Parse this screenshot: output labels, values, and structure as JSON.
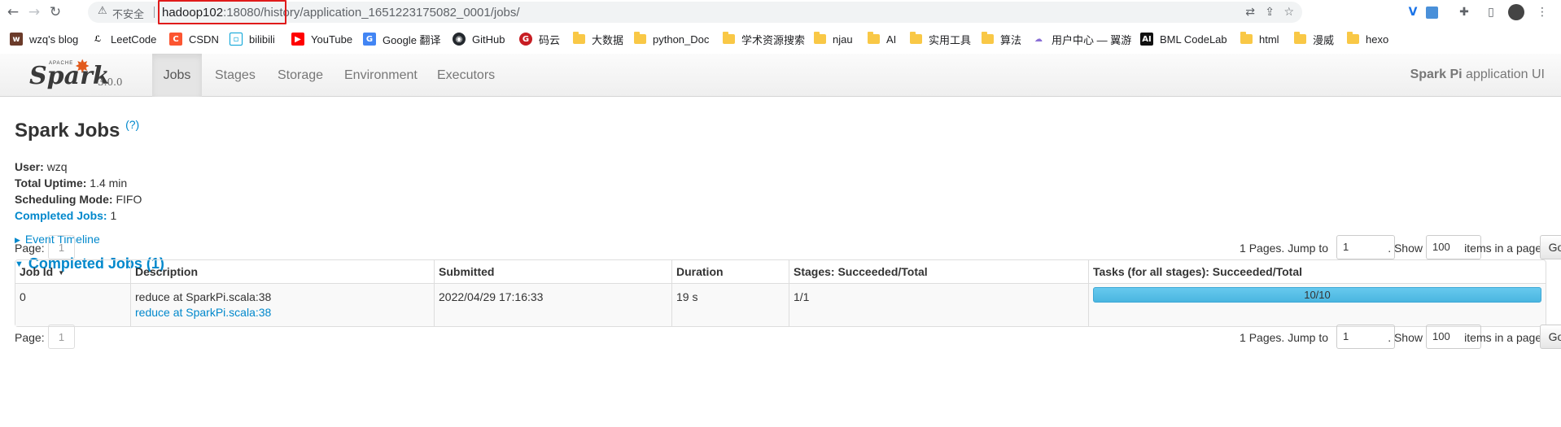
{
  "browser": {
    "security_label": "不安全",
    "url_host": "hadoop102",
    "url_rest": ":18080/history/application_1651223175082_0001/jobs/",
    "bookmarks": [
      {
        "label": "wzq's blog"
      },
      {
        "label": "LeetCode"
      },
      {
        "label": "CSDN"
      },
      {
        "label": "bilibili"
      },
      {
        "label": "YouTube"
      },
      {
        "label": "Google 翻译"
      },
      {
        "label": "GitHub"
      },
      {
        "label": "码云"
      },
      {
        "label": "大数据"
      },
      {
        "label": "python_Doc"
      },
      {
        "label": "学术资源搜索"
      },
      {
        "label": "njau"
      },
      {
        "label": "AI"
      },
      {
        "label": "实用工具"
      },
      {
        "label": "算法"
      },
      {
        "label": "用户中心 — 翼游"
      },
      {
        "label": "BML CodeLab"
      },
      {
        "label": "html"
      },
      {
        "label": "漫威"
      },
      {
        "label": "hexo"
      }
    ]
  },
  "spark": {
    "apache": "APACHE",
    "logo_text": "Spark",
    "version": "3.0.0",
    "tabs": [
      {
        "label": "Jobs"
      },
      {
        "label": "Stages"
      },
      {
        "label": "Storage"
      },
      {
        "label": "Environment"
      },
      {
        "label": "Executors"
      }
    ],
    "app_name": "Spark Pi",
    "app_suffix": " application UI"
  },
  "page": {
    "title": "Spark Jobs",
    "help": "(?)",
    "user_label": "User:",
    "user": "wzq",
    "uptime_label": "Total Uptime:",
    "uptime": "1.4 min",
    "mode_label": "Scheduling Mode:",
    "mode": "FIFO",
    "completed_label": "Completed Jobs:",
    "completed_count": "1",
    "event_timeline": "Event Timeline",
    "completed_header": "Completed Jobs (1)"
  },
  "pager": {
    "page_label": "Page:",
    "page": "1",
    "jump_text": "1 Pages. Jump to",
    "jump_value": "1",
    "show_text": ". Show",
    "show_value": "100",
    "items_text": "items in a page.",
    "go": "Go"
  },
  "table": {
    "headers": [
      "Job Id",
      "Description",
      "Submitted",
      "Duration",
      "Stages: Succeeded/Total",
      "Tasks (for all stages): Succeeded/Total"
    ],
    "rows": [
      {
        "job_id": "0",
        "desc": "reduce at SparkPi.scala:38",
        "desc_link": "reduce at SparkPi.scala:38",
        "submitted": "2022/04/29 17:16:33",
        "duration": "19 s",
        "stages": "1/1",
        "tasks": "10/10",
        "tasks_fraction": 1.0
      }
    ]
  }
}
